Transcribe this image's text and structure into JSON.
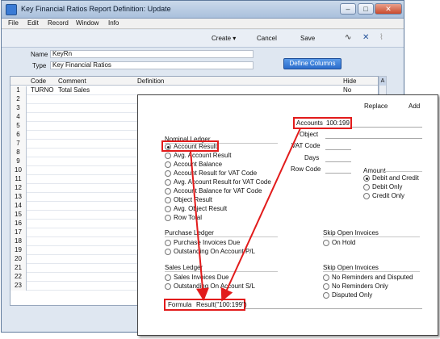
{
  "window": {
    "title": "Key Financial Ratios Report Definition: Update",
    "controls": [
      "–",
      "□",
      "✕"
    ]
  },
  "menu": [
    "File",
    "Edit",
    "Record",
    "Window",
    "Info"
  ],
  "toolbar": {
    "create": "Create",
    "cancel": "Cancel",
    "save": "Save",
    "icons": [
      "activity-icon",
      "expand-icon",
      "paperclip-icon"
    ]
  },
  "header": {
    "name_label": "Name",
    "name_value": "KeyRn",
    "type_label": "Type",
    "type_value": "Key Financial Ratios",
    "define_columns": "Define Columns"
  },
  "grid": {
    "columns": [
      "Code",
      "Comment",
      "Definition",
      "Hide"
    ],
    "scroll_label": "A",
    "rows": [
      {
        "num": "1",
        "code": "TURNO",
        "comment": "Total Sales",
        "hide": "No"
      },
      {
        "num": "2"
      },
      {
        "num": "3"
      },
      {
        "num": "4"
      },
      {
        "num": "5"
      },
      {
        "num": "6"
      },
      {
        "num": "7"
      },
      {
        "num": "8"
      },
      {
        "num": "9"
      },
      {
        "num": "10"
      },
      {
        "num": "11"
      },
      {
        "num": "12"
      },
      {
        "num": "13"
      },
      {
        "num": "14"
      },
      {
        "num": "15"
      },
      {
        "num": "16"
      },
      {
        "num": "17"
      },
      {
        "num": "18"
      },
      {
        "num": "19"
      },
      {
        "num": "20"
      },
      {
        "num": "21"
      },
      {
        "num": "22"
      },
      {
        "num": "23"
      }
    ]
  },
  "popup": {
    "replace": "Replace",
    "add": "Add",
    "accounts_label": "Accounts",
    "accounts_value": "100:199",
    "object_label": "Object",
    "vat_code_label": "VAT Code",
    "days_label": "Days",
    "row_code_label": "Row Code",
    "nominal_ledger": "Nominal Ledger",
    "nominal_options": [
      "Account Result",
      "Avg. Account Result",
      "Account Balance",
      "Account Result for VAT Code",
      "Avg. Account Result for VAT Code",
      "Account Balance for VAT Code",
      "Object Result",
      "Avg. Object Result",
      "Row Total"
    ],
    "amount_label": "Amount",
    "amount_options": [
      "Debit and Credit",
      "Debit Only",
      "Credit Only"
    ],
    "purchase_ledger": "Purchase Ledger",
    "purchase_options": [
      "Purchase Invoices Due",
      "Outstanding On Account P/L"
    ],
    "skip_open_invoices_1": "Skip Open Invoices",
    "skip_options_1": [
      "On Hold"
    ],
    "sales_ledger": "Sales Ledger",
    "sales_options": [
      "Sales Invoices Due",
      "Outstanding On Account S/L"
    ],
    "skip_open_invoices_2": "Skip Open Invoices",
    "skip_options_2": [
      "No Reminders and Disputed",
      "No Reminders Only",
      "Disputed Only"
    ],
    "formula_label": "Formula",
    "formula_value": "Result(\"100:199\")"
  },
  "colors": {
    "highlight": "#e21b1b",
    "accent": "#2b6dcc"
  }
}
